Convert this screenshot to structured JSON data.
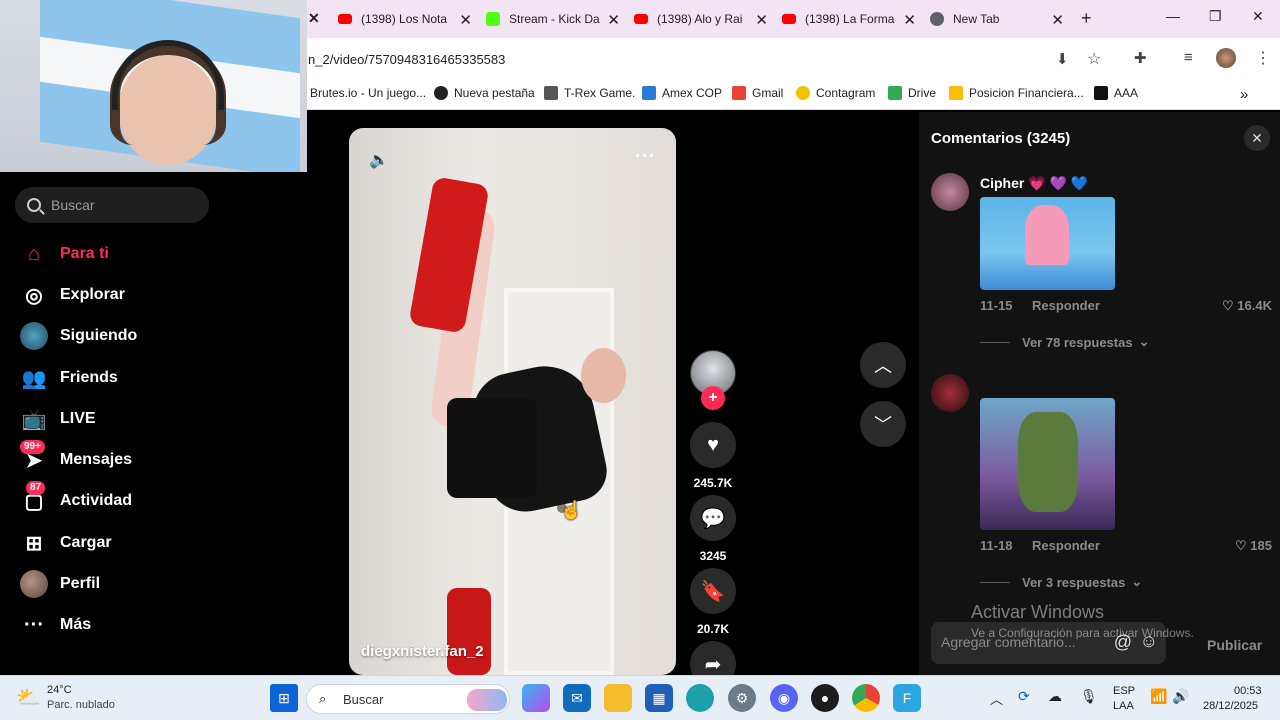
{
  "browser": {
    "tabs": [
      {
        "label": "(1398) Los Nota",
        "favicon_color": "#ff0000"
      },
      {
        "label": "Stream - Kick Da",
        "favicon_color": "#53fc18"
      },
      {
        "label": "(1398) Alo y Rai",
        "favicon_color": "#ff0000"
      },
      {
        "label": "(1398) La Forma",
        "favicon_color": "#ff0000"
      },
      {
        "label": "New Tab",
        "favicon_color": "#5f6368"
      }
    ],
    "new_tab": "+",
    "url": "n_2/video/7570948316465335583",
    "bookmarks": [
      "Brutes.io - Un juego...",
      "Nueva pestaña",
      "T-Rex Game.",
      "Amex COP",
      "Gmail",
      "Contagram",
      "Drive",
      "Posicion Financiera...",
      "AAA"
    ],
    "bookmarks_more": "»"
  },
  "sidebar": {
    "search_placeholder": "Buscar",
    "items": [
      {
        "label": "Para ti",
        "icon": "home-icon",
        "active": true
      },
      {
        "label": "Explorar",
        "icon": "compass-icon"
      },
      {
        "label": "Siguiendo",
        "icon": "following-avatar-icon"
      },
      {
        "label": "Friends",
        "icon": "friends-icon"
      },
      {
        "label": "LIVE",
        "icon": "live-icon"
      },
      {
        "label": "Mensajes",
        "icon": "messages-icon",
        "badge": "99+"
      },
      {
        "label": "Actividad",
        "icon": "activity-icon",
        "badge": "87"
      },
      {
        "label": "Cargar",
        "icon": "upload-icon"
      },
      {
        "label": "Perfil",
        "icon": "profile-avatar-icon"
      },
      {
        "label": "Más",
        "icon": "more-icon"
      }
    ]
  },
  "video": {
    "author": "diegxnister.fan_2",
    "likes": "245.7K",
    "comments": "3245",
    "saves": "20.7K"
  },
  "comments_panel": {
    "title": "Comentarios (3245)",
    "comments": [
      {
        "user": "Cipher 💗 💜 💙",
        "date": "11-15",
        "reply": "Responder",
        "likes": "16.4K",
        "more_replies": "Ver 78 respuestas"
      },
      {
        "user": "",
        "date": "11-18",
        "reply": "Responder",
        "likes": "185",
        "more_replies": "Ver 3 respuestas"
      }
    ],
    "composer_placeholder": "Agregar comentario...",
    "publish": "Publicar",
    "watermark_title": "Activar Windows",
    "watermark_sub": "Ve a Configuración para activar Windows."
  },
  "taskbar": {
    "weather_temp": "24°C",
    "weather_desc": "Parc. nublado",
    "search_placeholder": "Buscar",
    "lang_1": "ESP",
    "lang_2": "LAA",
    "time": "00:53",
    "date": "28/12/2025"
  },
  "colors": {
    "accent": "#fe2c55"
  }
}
